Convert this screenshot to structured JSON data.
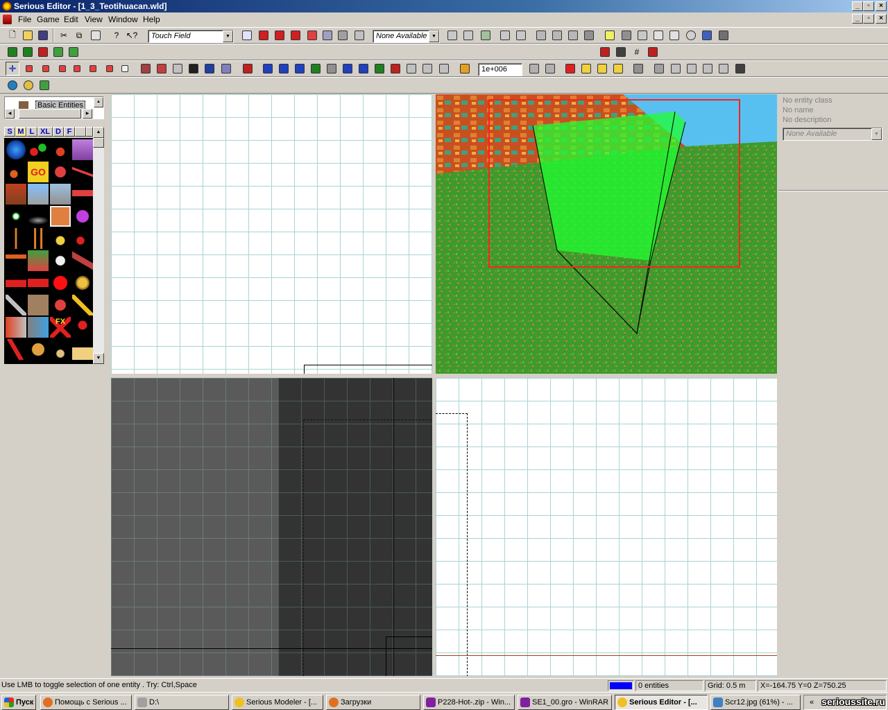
{
  "window": {
    "title": "Serious Editor - [1_3_Teotihuacan.wld]"
  },
  "menu": {
    "items": [
      "File",
      "Game",
      "Edit",
      "View",
      "Window",
      "Help"
    ]
  },
  "toolbar": {
    "class_combo": "Touch Field",
    "avail_combo": "None Available",
    "value_field": "1e+006"
  },
  "browser": {
    "tree_item": "Basic Entities",
    "size_tabs": [
      "S",
      "M",
      "L",
      "XL",
      "D",
      "F"
    ]
  },
  "properties": {
    "entity_class": "No entity class",
    "name": "No name",
    "description": "No description",
    "combo": "None Available"
  },
  "status": {
    "hint": "Use LMB to toggle selection of one entity . Try: Ctrl,Space",
    "entities": "0 entities",
    "grid": "Grid: 0.5 m",
    "coords": "X=-164.75 Y=0 Z=750.25",
    "swatch_color": "#0000ff"
  },
  "taskbar": {
    "start": "Пуск",
    "tasks": [
      "Помощь с Serious ...",
      "D:\\",
      "Serious Modeler - [...",
      "Загрузки",
      "P228-Hot-.zip - Win...",
      "SE1_00.gro - WinRAR",
      "Serious Editor - [...",
      "Scr12.jpg (61%) - ..."
    ],
    "tray": "«"
  },
  "watermark": "serioussite.ru"
}
